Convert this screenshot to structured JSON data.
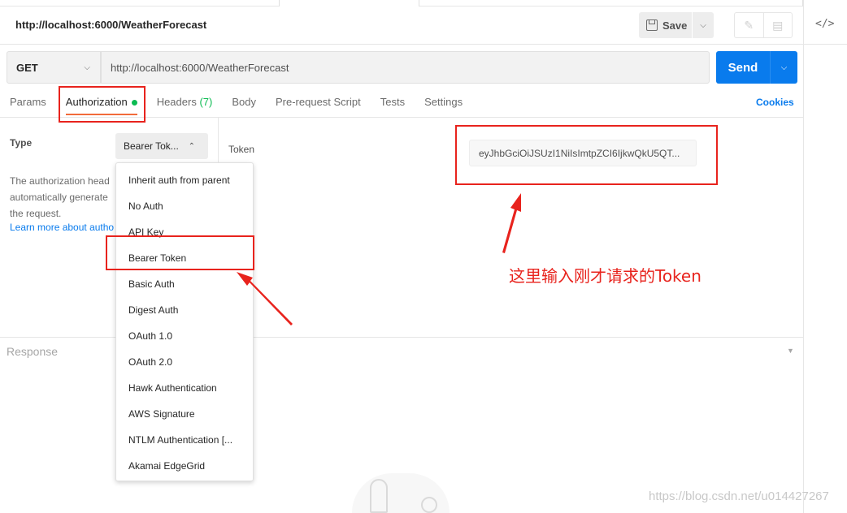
{
  "request": {
    "title": "http://localhost:6000/WeatherForecast",
    "method": "GET",
    "url": "http://localhost:6000/WeatherForecast",
    "save_label": "Save",
    "send_label": "Send"
  },
  "tabs": {
    "params": "Params",
    "authorization": "Authorization",
    "headers": "Headers",
    "headers_count": "(7)",
    "body": "Body",
    "pre_request": "Pre-request Script",
    "tests": "Tests",
    "settings": "Settings",
    "cookies": "Cookies"
  },
  "auth": {
    "type_label": "Type",
    "selected_type": "Bearer Tok...",
    "description": "The authorization head automatically generate the request.",
    "desc_line1": "The authorization head",
    "desc_line2": "automatically generate",
    "desc_line3": "the request.",
    "learn_more": "Learn more about autho",
    "token_label": "Token",
    "token_value": "eyJhbGciOiJSUzI1NiIsImtpZCI6IjkwQkU5QT..."
  },
  "dropdown": {
    "items": [
      "Inherit auth from parent",
      "No Auth",
      "API Key",
      "Bearer Token",
      "Basic Auth",
      "Digest Auth",
      "OAuth 1.0",
      "OAuth 2.0",
      "Hawk Authentication",
      "AWS Signature",
      "NTLM Authentication [...",
      "Akamai EdgeGrid"
    ]
  },
  "response": {
    "label": "Response"
  },
  "annotation": {
    "text": "这里输入刚才请求的Token",
    "color": "#e8231d"
  },
  "watermark": "https://blog.csdn.net/u014427267",
  "colors": {
    "accent": "#097bed",
    "tab_underline": "#f26b3a",
    "status_green": "#0cbb52"
  }
}
